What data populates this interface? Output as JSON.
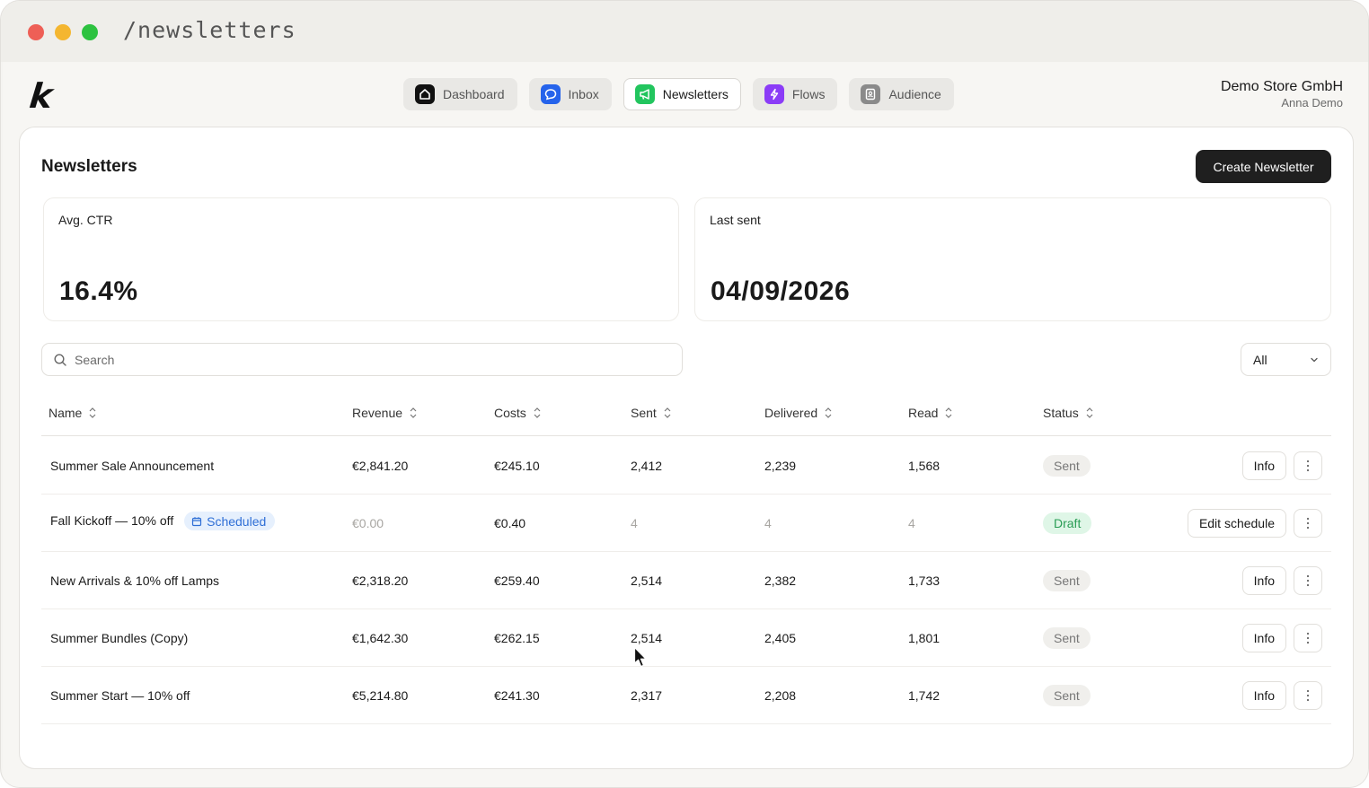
{
  "window": {
    "path": "/newsletters"
  },
  "app": {
    "logo": "k"
  },
  "nav": [
    {
      "label": "Dashboard",
      "icon": "home-icon",
      "color": "#111111"
    },
    {
      "label": "Inbox",
      "icon": "chat-icon",
      "color": "#2563eb"
    },
    {
      "label": "Newsletters",
      "icon": "megaphone-icon",
      "color": "#22c55e"
    },
    {
      "label": "Flows",
      "icon": "lightning-icon",
      "color": "#8b3cf7"
    },
    {
      "label": "Audience",
      "icon": "contacts-icon",
      "color": "#8a8a8a"
    }
  ],
  "account": {
    "company": "Demo Store GmbH",
    "user": "Anna Demo"
  },
  "page": {
    "title": "Newsletters",
    "create_label": "Create Newsletter"
  },
  "stats": [
    {
      "label": "Avg. CTR",
      "value": "16.4%"
    },
    {
      "label": "Last sent",
      "value": "04/09/2026"
    }
  ],
  "search": {
    "placeholder": "Search"
  },
  "filter": {
    "selected": "All"
  },
  "table": {
    "columns": [
      "Name",
      "Revenue",
      "Costs",
      "Sent",
      "Delivered",
      "Read",
      "Status"
    ],
    "rows": [
      {
        "name": "Summer Sale Announcement",
        "badge": "",
        "revenue": "€2,841.20",
        "costs": "€245.10",
        "sent": "2,412",
        "delivered": "2,239",
        "read": "1,568",
        "status": "Sent",
        "action": "Info"
      },
      {
        "name": "Fall Kickoff — 10% off",
        "badge": "Scheduled",
        "revenue": "€0.00",
        "costs": "€0.40",
        "sent": "4",
        "delivered": "4",
        "read": "4",
        "status": "Draft",
        "action": "Edit schedule"
      },
      {
        "name": "New Arrivals & 10% off Lamps",
        "badge": "",
        "revenue": "€2,318.20",
        "costs": "€259.40",
        "sent": "2,514",
        "delivered": "2,382",
        "read": "1,733",
        "status": "Sent",
        "action": "Info"
      },
      {
        "name": "Summer Bundles (Copy)",
        "badge": "",
        "revenue": "€1,642.30",
        "costs": "€262.15",
        "sent": "2,514",
        "delivered": "2,405",
        "read": "1,801",
        "status": "Sent",
        "action": "Info"
      },
      {
        "name": "Summer Start — 10% off",
        "badge": "",
        "revenue": "€5,214.80",
        "costs": "€241.30",
        "sent": "2,317",
        "delivered": "2,208",
        "read": "1,742",
        "status": "Sent",
        "action": "Info"
      }
    ]
  },
  "colors": {
    "status_sent_bg": "#f0efec",
    "status_draft_bg": "#dff6e7",
    "status_draft_text": "#2a9d55",
    "scheduled_text": "#2f6fd6"
  }
}
